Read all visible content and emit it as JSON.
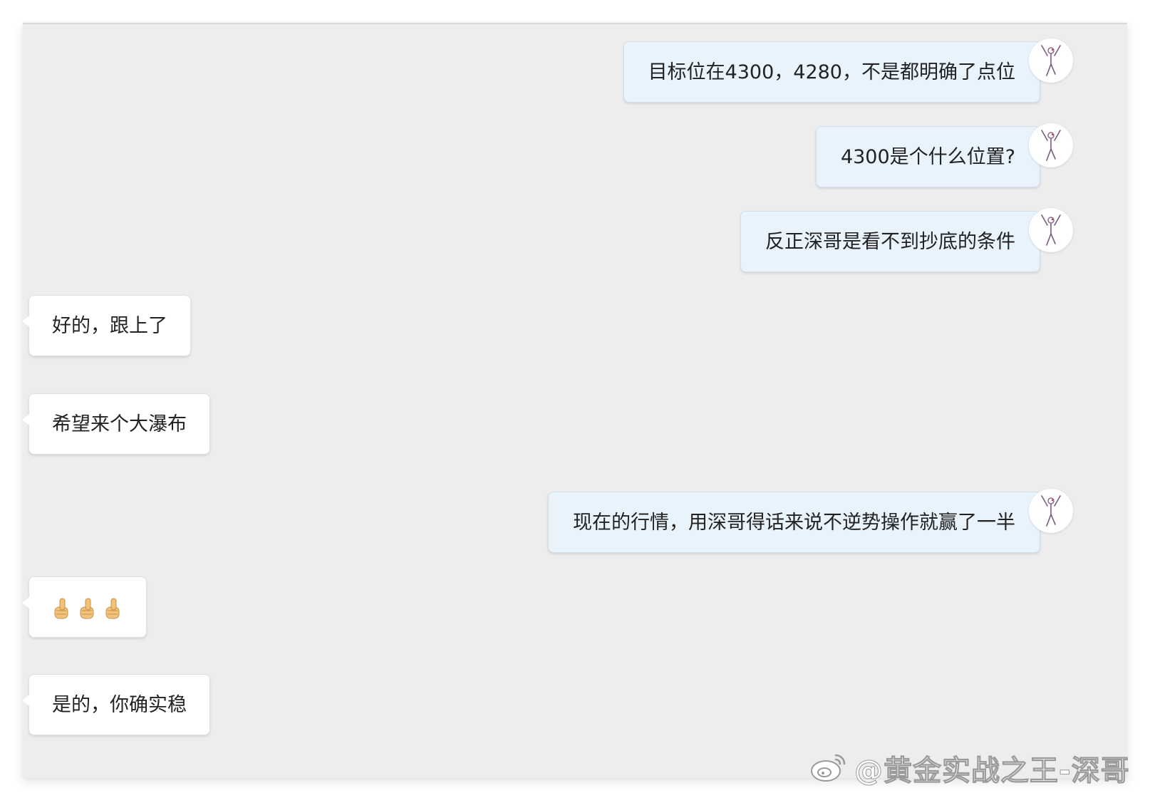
{
  "messages": [
    {
      "side": "out",
      "text": "目标位在4300，4280，不是都明确了点位"
    },
    {
      "side": "out",
      "text": "4300是个什么位置?"
    },
    {
      "side": "out",
      "text": "反正深哥是看不到抄底的条件"
    },
    {
      "side": "in",
      "text": "好的，跟上了"
    },
    {
      "side": "in",
      "text": "希望来个大瀑布"
    },
    {
      "side": "out",
      "text": "现在的行情，用深哥得话来说不逆势操作就赢了一半"
    },
    {
      "side": "in",
      "emoji": "thumbs-up x3"
    },
    {
      "side": "in",
      "text": "是的，你确实稳"
    }
  ],
  "watermark": {
    "text": "@黄金实战之王-深哥",
    "icon": "weibo-logo-icon"
  },
  "colors": {
    "chat_background": "#ededed",
    "outgoing_bubble": "#e9f3fc",
    "incoming_bubble": "#ffffff",
    "text": "#222222"
  }
}
